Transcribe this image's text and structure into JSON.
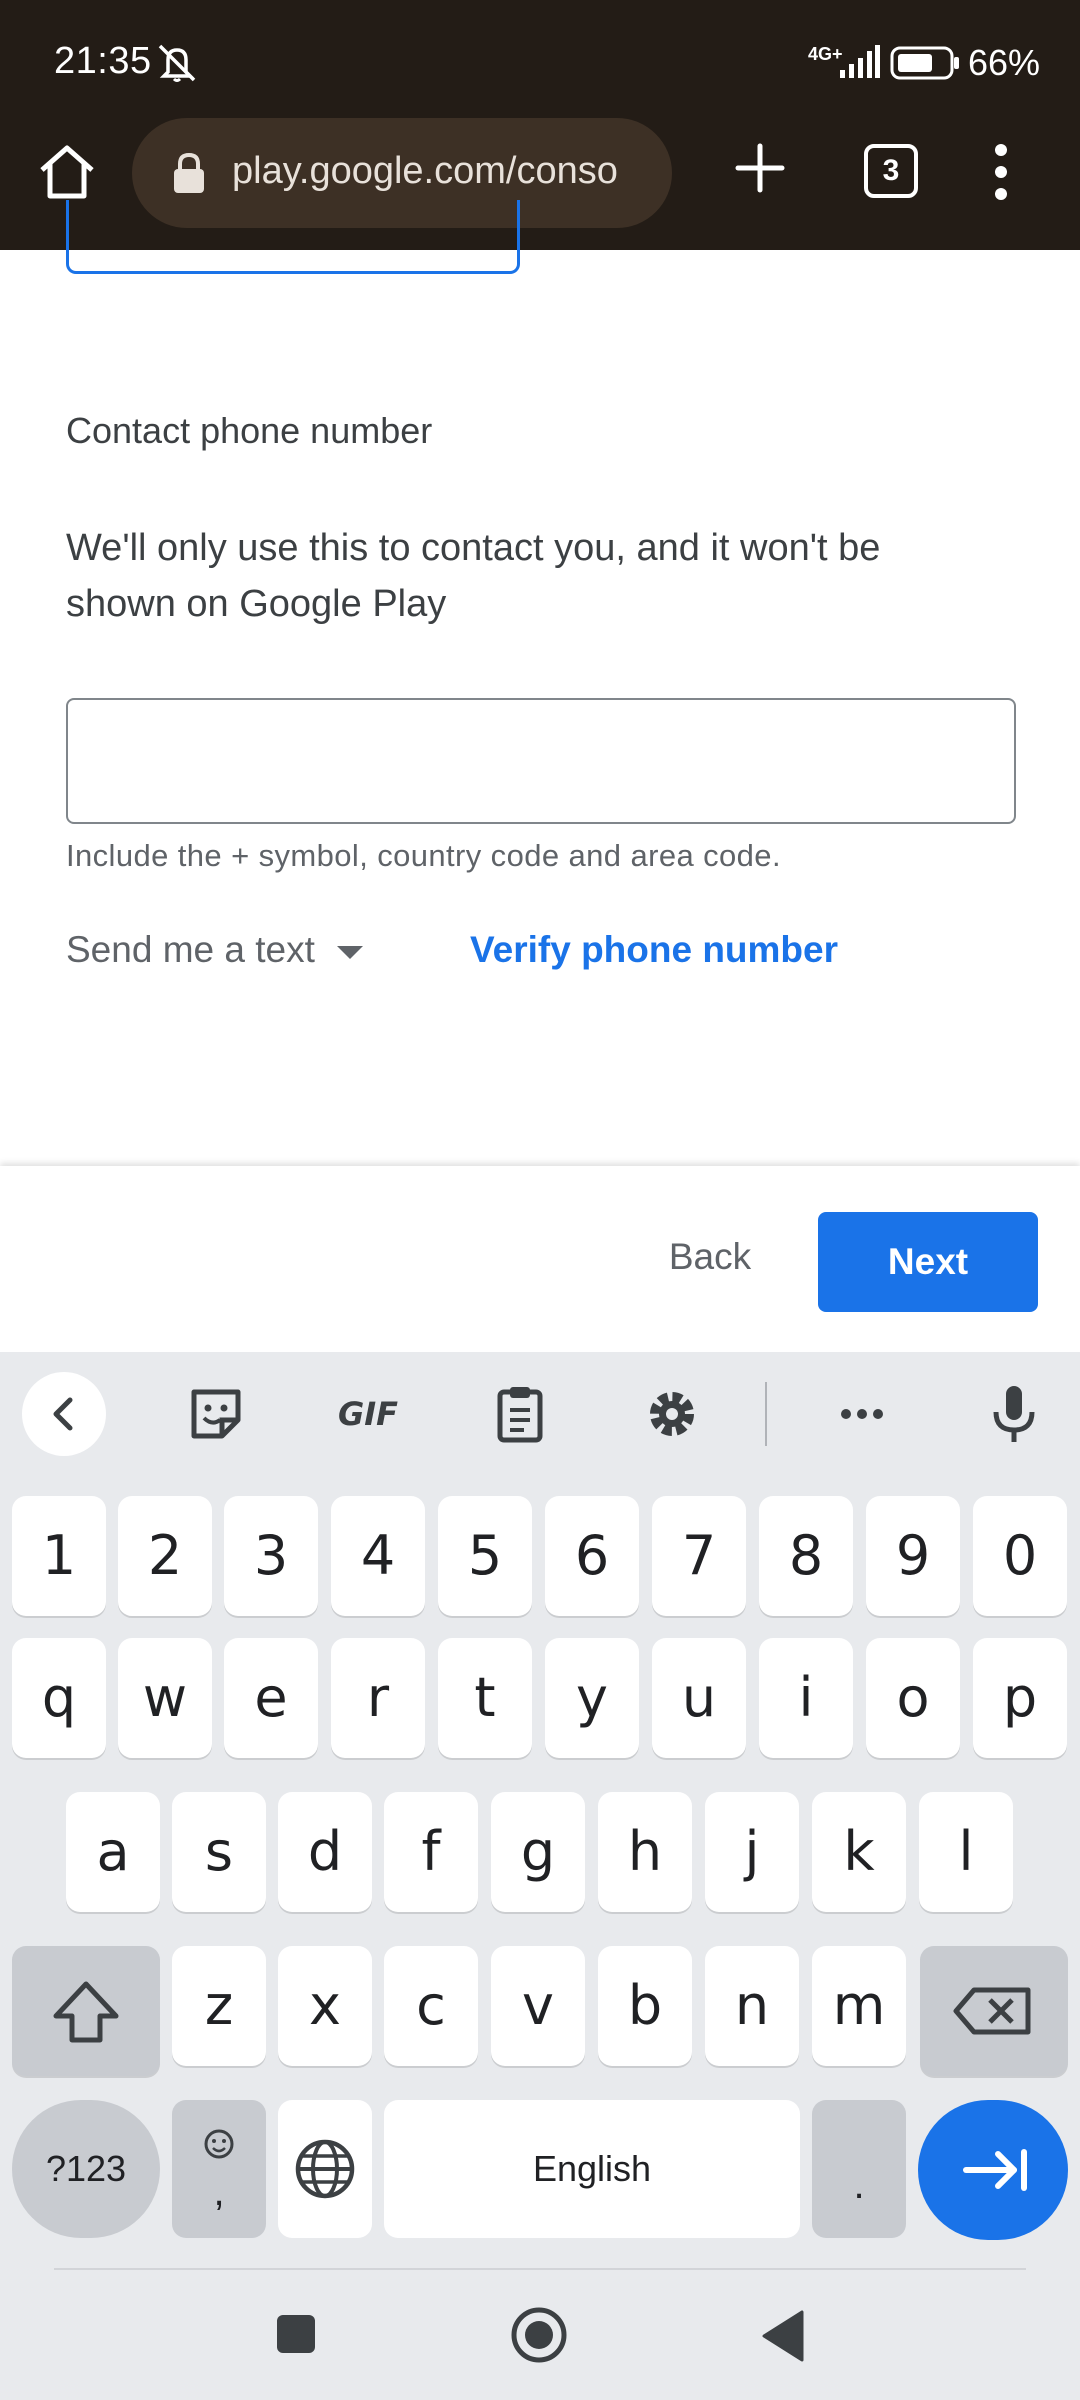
{
  "status_bar": {
    "time": "21:35",
    "network": "4G+",
    "battery": "66%",
    "battery_level": 0.66
  },
  "browser": {
    "url": "play.google.com/conso",
    "tab_count": "3"
  },
  "form": {
    "field_title": "Contact phone number",
    "field_description": "We'll only use this to contact you, and it won't be shown on Google Play",
    "phone_value": "",
    "hint": "Include the + symbol, country code and area code.",
    "verification_method": "Send me a text",
    "verify_link": "Verify phone number"
  },
  "footer": {
    "back_label": "Back",
    "next_label": "Next"
  },
  "keyboard": {
    "toolbar": [
      "back-icon",
      "sticker-icon",
      "GIF",
      "clipboard-icon",
      "gear-icon",
      "more-icon",
      "mic-icon"
    ],
    "gif_label": "GIF",
    "row1": [
      "1",
      "2",
      "3",
      "4",
      "5",
      "6",
      "7",
      "8",
      "9",
      "0"
    ],
    "row2": [
      "q",
      "w",
      "e",
      "r",
      "t",
      "y",
      "u",
      "i",
      "o",
      "p"
    ],
    "row3": [
      "a",
      "s",
      "d",
      "f",
      "g",
      "h",
      "j",
      "k",
      "l"
    ],
    "row4": [
      "z",
      "x",
      "c",
      "v",
      "b",
      "n",
      "m"
    ],
    "symbols_label": "?123",
    "comma_label": ",",
    "space_label": "English",
    "period_label": ".",
    "accent": "#1a73e8"
  },
  "colors": {
    "browser_bar": "#231c16",
    "url_pill": "#3d3025",
    "primary": "#1a73e8",
    "text": "#3c4043",
    "keyboard_bg": "#e8eaed"
  }
}
